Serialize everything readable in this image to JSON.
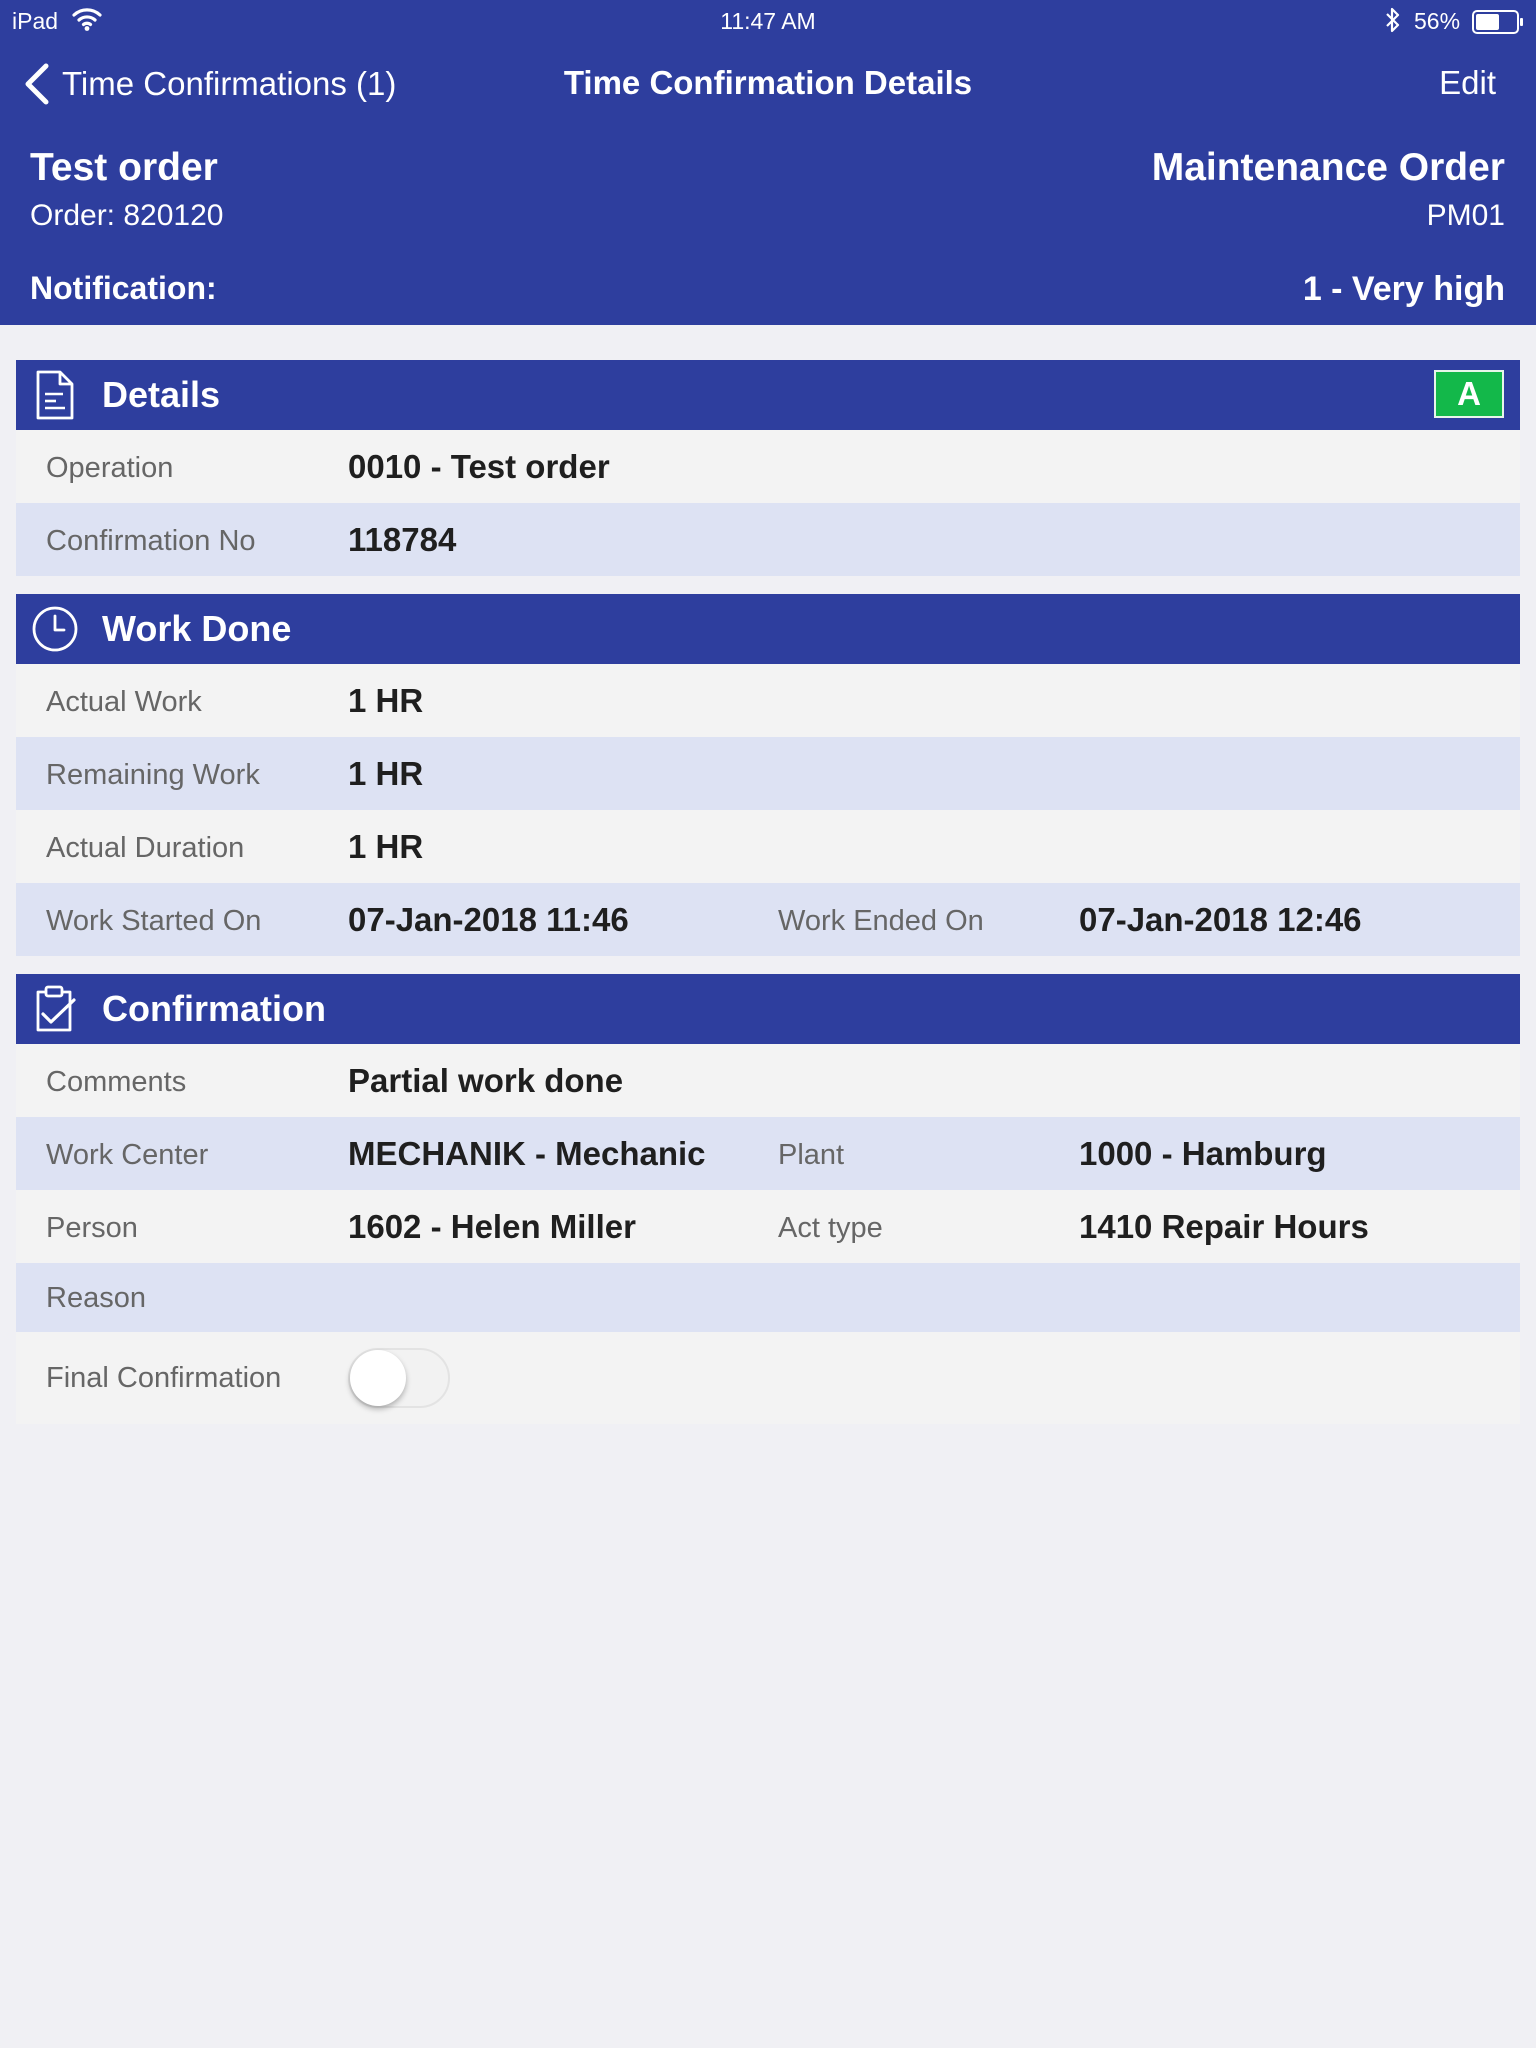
{
  "status_bar": {
    "device": "iPad",
    "time": "11:47 AM",
    "battery": "56%"
  },
  "nav": {
    "back_label": "Time Confirmations (1)",
    "title": "Time Confirmation Details",
    "edit_label": "Edit"
  },
  "header": {
    "title": "Test order",
    "order": "Order: 820120",
    "order_type": "Maintenance Order",
    "order_type_code": "PM01",
    "notification_label": "Notification:",
    "priority": "1 - Very high"
  },
  "colors": {
    "primary": "#2e3e9e",
    "row_alt": "#dde2f3",
    "badge_green": "#13b84a"
  },
  "details": {
    "title": "Details",
    "badge": "A",
    "operation_label": "Operation",
    "operation_value": "0010 - Test order",
    "confirmation_no_label": "Confirmation No",
    "confirmation_no_value": "118784"
  },
  "work_done": {
    "title": "Work Done",
    "actual_work_label": "Actual Work",
    "actual_work_value": "1 HR",
    "remaining_work_label": "Remaining Work",
    "remaining_work_value": "1 HR",
    "actual_duration_label": "Actual Duration",
    "actual_duration_value": "1 HR",
    "started_label": "Work Started On",
    "started_value": "07-Jan-2018 11:46",
    "ended_label": "Work Ended On",
    "ended_value": "07-Jan-2018 12:46"
  },
  "confirmation": {
    "title": "Confirmation",
    "comments_label": "Comments",
    "comments_value": "Partial work done",
    "work_center_label": "Work Center",
    "work_center_value": "MECHANIK - Mechanic",
    "plant_label": "Plant",
    "plant_value": "1000 - Hamburg",
    "person_label": "Person",
    "person_value": "1602 - Helen Miller",
    "act_type_label": "Act type",
    "act_type_value": "1410 Repair Hours",
    "reason_label": "Reason",
    "final_label": "Final Confirmation",
    "final_on": false
  }
}
